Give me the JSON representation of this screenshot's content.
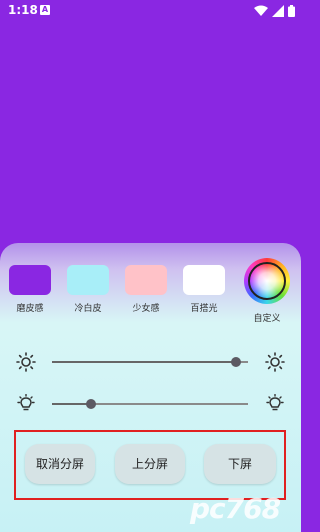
{
  "status_bar": {
    "time": "1:18",
    "notification_icon": "a-badge-icon"
  },
  "swatches": [
    {
      "label": "磨皮感",
      "color": "#8a27e2"
    },
    {
      "label": "冷白皮",
      "color": "#a8eef8"
    },
    {
      "label": "少女感",
      "color": "#ffc2c8"
    },
    {
      "label": "百搭光",
      "color": "#ffffff"
    }
  ],
  "custom": {
    "label": "自定义",
    "icon": "color-wheel-icon"
  },
  "sliders": {
    "brightness": {
      "icon": "sun-icon",
      "value": 0.94
    },
    "warmth": {
      "icon": "bulb-icon",
      "value": 0.2
    }
  },
  "buttons": {
    "cancel_split": "取消分屏",
    "upper_screen": "上分屏",
    "lower_screen": "下屏"
  },
  "colors": {
    "background": "#8a27e2",
    "highlight_frame": "#e02020"
  },
  "watermark": "pc768"
}
